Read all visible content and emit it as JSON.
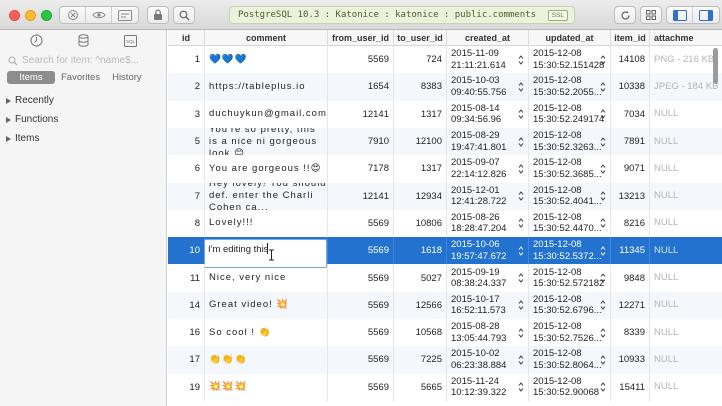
{
  "window": {
    "connection_label": "PostgreSQL 10.3 : Katonice : katonice : public.comments",
    "ssl_badge": "SSL"
  },
  "sidebar": {
    "search_placeholder": "Search for item: ^name$...",
    "tabs": [
      {
        "label": "Items",
        "active": true
      },
      {
        "label": "Favorites",
        "active": false
      },
      {
        "label": "History",
        "active": false
      }
    ],
    "tree": [
      {
        "label": "Recently"
      },
      {
        "label": "Functions"
      },
      {
        "label": "Items"
      }
    ]
  },
  "table": {
    "columns": [
      "id",
      "comment",
      "from_user_id",
      "to_user_id",
      "created_at",
      "updated_at",
      "item_id",
      "attachme"
    ],
    "rows": [
      {
        "id": "1",
        "comment": "💙💙💙",
        "from": "5569",
        "to": "724",
        "c1": "2015-11-09",
        "c2": "21:11:21.614",
        "u1": "2015-12-08",
        "u2": "15:30:52.151428",
        "item": "14108",
        "att": "PNG - 216 KB"
      },
      {
        "id": "2",
        "comment": "https://tableplus.io",
        "from": "1654",
        "to": "8383",
        "c1": "2015-10-03",
        "c2": "09:40:55.756",
        "u1": "2015-12-08",
        "u2": "15:30:52.2055...",
        "item": "10338",
        "att": "JPEG - 184 KB"
      },
      {
        "id": "3",
        "comment": "duchuykun@gmail.com",
        "from": "12141",
        "to": "1317",
        "c1": "2015-08-14",
        "c2": "09:34:56.96",
        "u1": "2015-12-08",
        "u2": "15:30:52.249174",
        "item": "7034",
        "att": "NULL"
      },
      {
        "id": "5",
        "comment": "You're so pretty, this is a nice ni gorgeous look 😊",
        "from": "7910",
        "to": "12100",
        "c1": "2015-08-29",
        "c2": "19:47:41.801",
        "u1": "2015-12-08",
        "u2": "15:30:52.3263...",
        "item": "7891",
        "att": "NULL"
      },
      {
        "id": "6",
        "comment": "You are gorgeous !!😍",
        "from": "7178",
        "to": "1317",
        "c1": "2015-09-07",
        "c2": "22:14:12.826",
        "u1": "2015-12-08",
        "u2": "15:30:52.3685...",
        "item": "9071",
        "att": "NULL"
      },
      {
        "id": "7",
        "comment": "Hey lovely! You should def. enter the Charli Cohen ca...",
        "from": "12141",
        "to": "12934",
        "c1": "2015-12-01",
        "c2": "12:41:28.722",
        "u1": "2015-12-08",
        "u2": "15:30:52.4041...",
        "item": "13213",
        "att": "NULL"
      },
      {
        "id": "8",
        "comment": "Lovely!!!",
        "from": "5569",
        "to": "10806",
        "c1": "2015-08-26",
        "c2": "18:28:47.204",
        "u1": "2015-12-08",
        "u2": "15:30:52.4470...",
        "item": "8216",
        "att": "NULL"
      },
      {
        "id": "10",
        "comment": "I'm editing this",
        "from": "5569",
        "to": "1618",
        "c1": "2015-10-06",
        "c2": "19:57:47.672",
        "u1": "2015-12-08",
        "u2": "15:30:52.5372...",
        "item": "11345",
        "att": "NULL",
        "selected": true
      },
      {
        "id": "11",
        "comment": "Nice, very nice",
        "from": "5569",
        "to": "5027",
        "c1": "2015-09-19",
        "c2": "08:38:24.337",
        "u1": "2015-12-08",
        "u2": "15:30:52.572182",
        "item": "9848",
        "att": "NULL"
      },
      {
        "id": "14",
        "comment": "Great video! 💥",
        "from": "5569",
        "to": "12566",
        "c1": "2015-10-17",
        "c2": "16:52:11.573",
        "u1": "2015-12-08",
        "u2": "15:30:52.6796...",
        "item": "12271",
        "att": "NULL"
      },
      {
        "id": "16",
        "comment": "So cool ! 👏",
        "from": "5569",
        "to": "10568",
        "c1": "2015-08-28",
        "c2": "13:05:44.793",
        "u1": "2015-12-08",
        "u2": "15:30:52.7526...",
        "item": "8339",
        "att": "NULL"
      },
      {
        "id": "17",
        "comment": "👏👏👏",
        "from": "5569",
        "to": "7225",
        "c1": "2015-10-02",
        "c2": "06:23:38.884",
        "u1": "2015-12-08",
        "u2": "15:30:52.8064...",
        "item": "10933",
        "att": "NULL"
      },
      {
        "id": "19",
        "comment": "💥💥💥",
        "from": "5569",
        "to": "5665",
        "c1": "2015-11-24",
        "c2": "10:12:39.322",
        "u1": "2015-12-08",
        "u2": "15:30:52.90068",
        "item": "15411",
        "att": "NULL"
      }
    ]
  }
}
